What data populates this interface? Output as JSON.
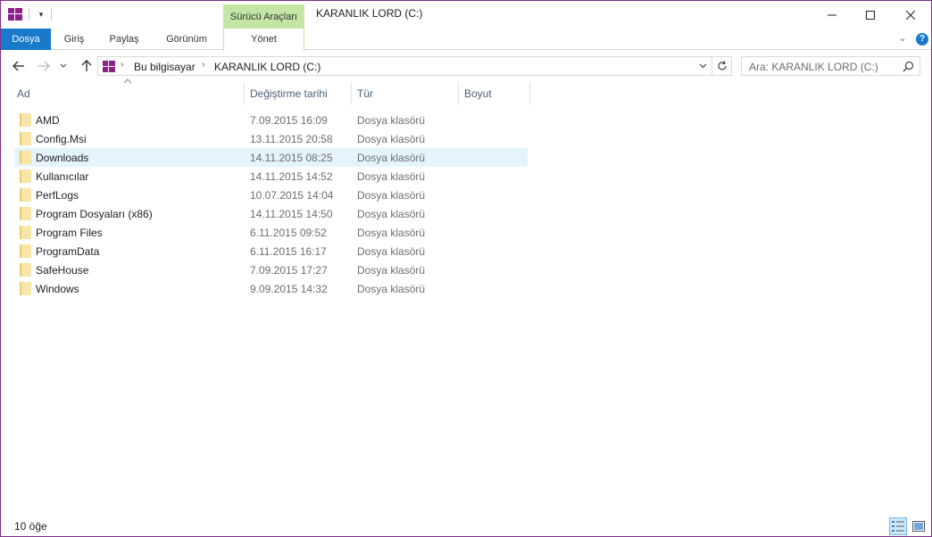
{
  "window": {
    "title": "KARANLIK LORD (C:)",
    "context_group": "Sürücü Araçları",
    "accent": "#1979ca",
    "context_color": "#c3e6a4",
    "border_color": "#7a2f86"
  },
  "ribbon": {
    "tabs": [
      "Dosya",
      "Giriş",
      "Paylaş",
      "Görünüm",
      "Yönet"
    ]
  },
  "address": {
    "crumbs": [
      "Bu bilgisayar",
      "KARANLIK LORD (C:)"
    ]
  },
  "search": {
    "placeholder": "Ara: KARANLIK LORD (C:)"
  },
  "columns": [
    "Ad",
    "Değiştirme tarihi",
    "Tür",
    "Boyut"
  ],
  "files": [
    {
      "name": "AMD",
      "date": "7.09.2015 16:09",
      "type": "Dosya klasörü"
    },
    {
      "name": "Config.Msi",
      "date": "13.11.2015 20:58",
      "type": "Dosya klasörü"
    },
    {
      "name": "Downloads",
      "date": "14.11.2015 08:25",
      "type": "Dosya klasörü"
    },
    {
      "name": "Kullanıcılar",
      "date": "14.11.2015 14:52",
      "type": "Dosya klasörü"
    },
    {
      "name": "PerfLogs",
      "date": "10.07.2015 14:04",
      "type": "Dosya klasörü"
    },
    {
      "name": "Program Dosyaları (x86)",
      "date": "14.11.2015 14:50",
      "type": "Dosya klasörü"
    },
    {
      "name": "Program Files",
      "date": "6.11.2015 09:52",
      "type": "Dosya klasörü"
    },
    {
      "name": "ProgramData",
      "date": "6.11.2015 16:17",
      "type": "Dosya klasörü"
    },
    {
      "name": "SafeHouse",
      "date": "7.09.2015 17:27",
      "type": "Dosya klasörü"
    },
    {
      "name": "Windows",
      "date": "9.09.2015 14:32",
      "type": "Dosya klasörü"
    }
  ],
  "selected_index": 2,
  "status": {
    "item_count": "10 öğe"
  },
  "icons": {
    "app": "windows-logo-icon",
    "folder": "folder-icon",
    "help": "help-icon",
    "back": "back-arrow-icon",
    "forward": "forward-arrow-icon",
    "up": "up-arrow-icon",
    "refresh": "refresh-icon",
    "search": "search-icon"
  }
}
